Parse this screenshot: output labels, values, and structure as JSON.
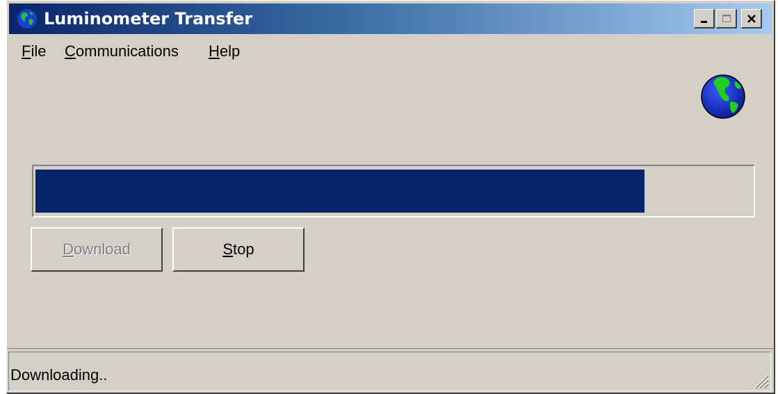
{
  "window": {
    "title": "Luminometer Transfer",
    "title_icon": "globe-icon",
    "controls": {
      "minimize_icon": "minimize-icon",
      "maximize_icon": "maximize-icon",
      "close_icon": "close-icon"
    }
  },
  "menu": {
    "items": [
      {
        "first": "F",
        "rest": "ile"
      },
      {
        "first": "C",
        "rest": "ommunications"
      },
      {
        "first": "H",
        "rest": "elp"
      }
    ]
  },
  "logo_icon": "globe-icon",
  "progress": {
    "fraction": 0.85,
    "fill_color": "#0a246a"
  },
  "buttons": {
    "download": {
      "first": "D",
      "rest": "ownload",
      "enabled": false
    },
    "stop": {
      "first": "S",
      "rest": "top",
      "enabled": true
    }
  },
  "status": {
    "text": "Downloading.."
  },
  "colors": {
    "face": "#d4d0c8",
    "title_start": "#0a246a",
    "title_end": "#a6caf0"
  }
}
